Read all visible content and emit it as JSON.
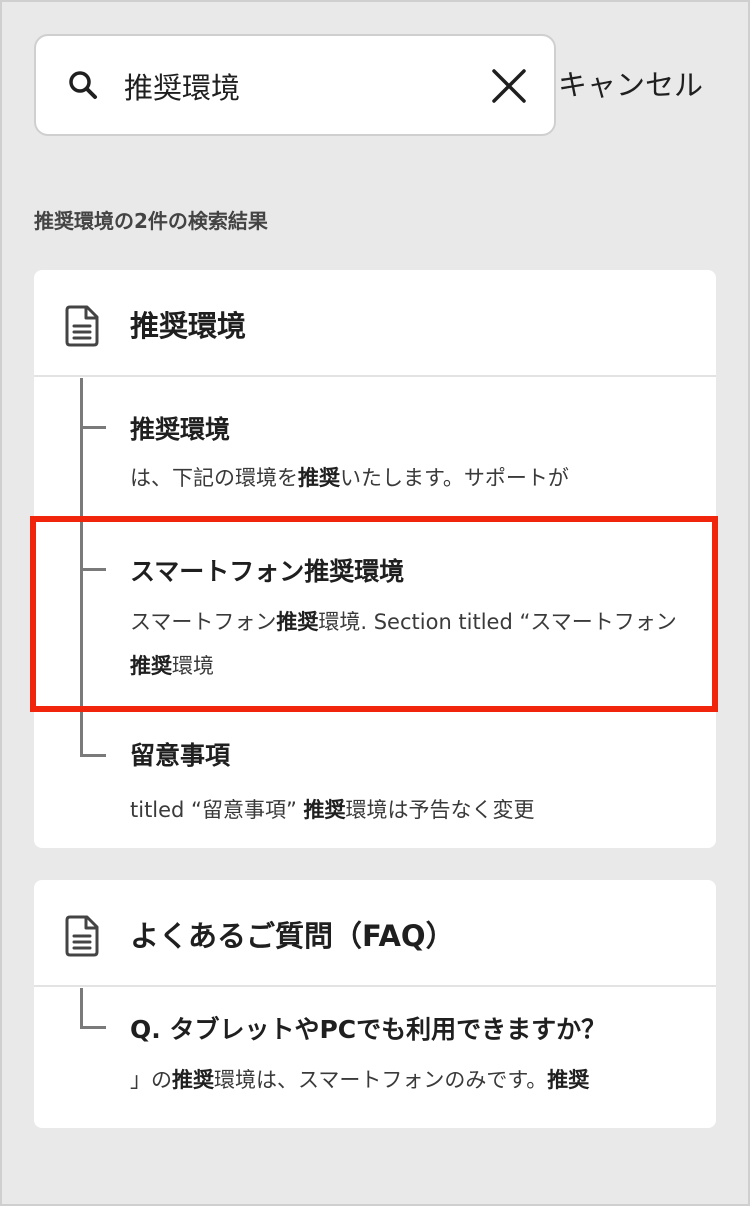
{
  "search": {
    "query": "推奨環境",
    "placeholder": "",
    "cancel_label": "キャンセル"
  },
  "results_summary": "推奨環境の2件の検索結果",
  "results": [
    {
      "title": "推奨環境",
      "icon": "document-icon",
      "items": [
        {
          "title": "推奨環境",
          "snippet": [
            {
              "text": "は、下記の環境を",
              "bold": false
            },
            {
              "text": "推奨",
              "bold": true
            },
            {
              "text": "いたします。サポートが",
              "bold": false
            }
          ]
        },
        {
          "title": "スマートフォン推奨環境",
          "snippet": [
            {
              "text": "スマートフォン",
              "bold": false
            },
            {
              "text": "推奨",
              "bold": true
            },
            {
              "text": "環境. Section titled “スマートフォン",
              "bold": false
            },
            {
              "text": "推奨",
              "bold": true
            },
            {
              "text": "環境",
              "bold": false
            }
          ],
          "highlighted": true
        },
        {
          "title": "留意事項",
          "snippet": [
            {
              "text": "titled “留意事項” ",
              "bold": false
            },
            {
              "text": "推奨",
              "bold": true
            },
            {
              "text": "環境は予告なく変更",
              "bold": false
            }
          ]
        }
      ]
    },
    {
      "title": "よくあるご質問（FAQ）",
      "icon": "document-icon",
      "items": [
        {
          "title": "Q. タブレットやPCでも利用できますか？",
          "snippet": [
            {
              "text": "」の",
              "bold": false
            },
            {
              "text": "推奨",
              "bold": true
            },
            {
              "text": "環境は、スマートフォンのみです。",
              "bold": false
            },
            {
              "text": "推奨",
              "bold": true
            }
          ]
        }
      ]
    }
  ],
  "colors": {
    "background": "#e9e9e9",
    "highlight_border": "#f0250b",
    "tree_line": "#7a7a7a"
  }
}
